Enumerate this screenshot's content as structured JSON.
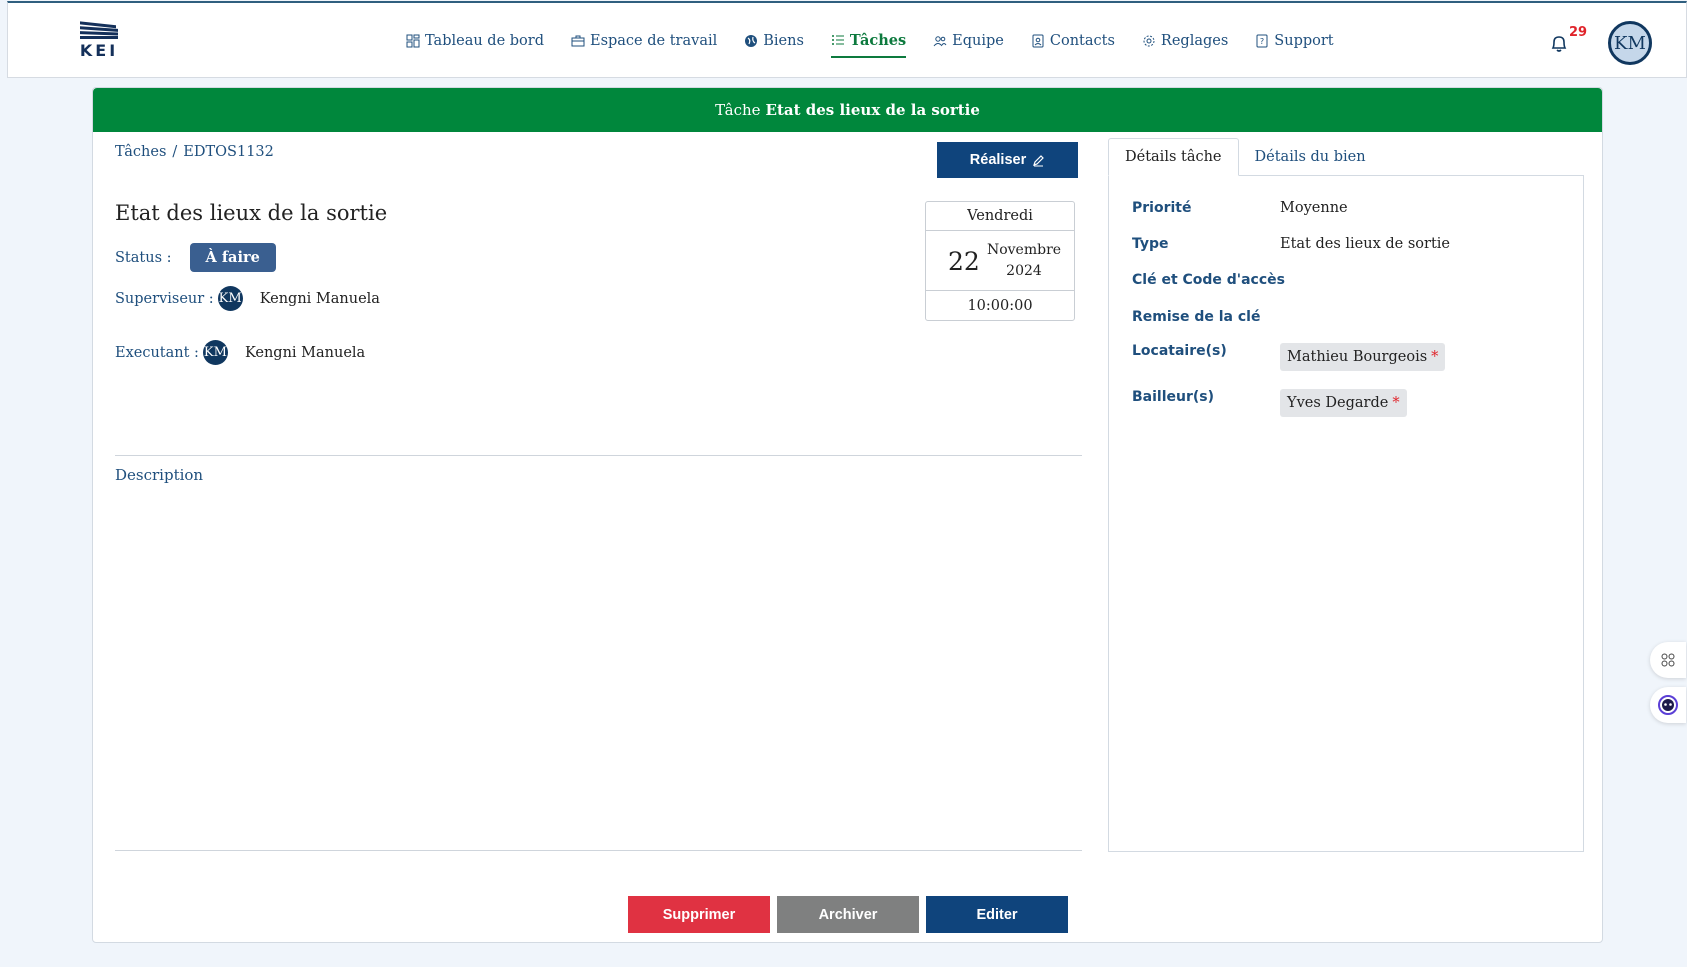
{
  "header": {
    "logo_text": "KEI",
    "nav": [
      {
        "label": "Tableau de bord",
        "icon": "dashboard-icon"
      },
      {
        "label": "Espace de travail",
        "icon": "briefcase-icon"
      },
      {
        "label": "Biens",
        "icon": "globe-icon"
      },
      {
        "label": "Tâches",
        "icon": "list-icon",
        "active": true
      },
      {
        "label": "Equipe",
        "icon": "team-icon"
      },
      {
        "label": "Contacts",
        "icon": "contacts-icon"
      },
      {
        "label": "Reglages",
        "icon": "gear-icon"
      },
      {
        "label": "Support",
        "icon": "help-icon"
      }
    ],
    "notifications_count": "29",
    "user_initials": "KM"
  },
  "banner": {
    "prefix": "Tâche",
    "title": "Etat des lieux de la sortie"
  },
  "breadcrumb": {
    "root": "Tâches",
    "separator": "/",
    "current": "EDTOS1132"
  },
  "actions": {
    "realiser_label": "Réaliser"
  },
  "task": {
    "title": "Etat des lieux de la sortie",
    "status_label": "Status :",
    "status_value": "À faire",
    "supervisor_label": "Superviseur :",
    "supervisor_initials": "KM",
    "supervisor_name": "Kengni Manuela",
    "executor_label": "Executant :",
    "executor_initials": "KM",
    "executor_name": "Kengni Manuela",
    "description_label": "Description"
  },
  "date": {
    "weekday": "Vendredi",
    "day": "22",
    "month": "Novembre",
    "year": "2024",
    "time": "10:00:00"
  },
  "tabs": {
    "details_task": "Détails tâche",
    "details_property": "Détails du bien"
  },
  "details": {
    "priority_label": "Priorité",
    "priority_value": "Moyenne",
    "type_label": "Type",
    "type_value": "Etat des lieux de sortie",
    "key_code_label": "Clé et Code d'accès",
    "key_handover_label": "Remise de la clé",
    "tenants_label": "Locataire(s)",
    "tenant_name": "Mathieu Bourgeois",
    "landlords_label": "Bailleur(s)",
    "landlord_name": "Yves Degarde",
    "required_mark": "*"
  },
  "footer": {
    "delete_label": "Supprimer",
    "archive_label": "Archiver",
    "edit_label": "Editer"
  },
  "colors": {
    "banner": "#00873c",
    "primary": "#0f447c",
    "danger": "#e03242",
    "muted": "#7f8080",
    "active_nav": "#0d7a3e"
  }
}
